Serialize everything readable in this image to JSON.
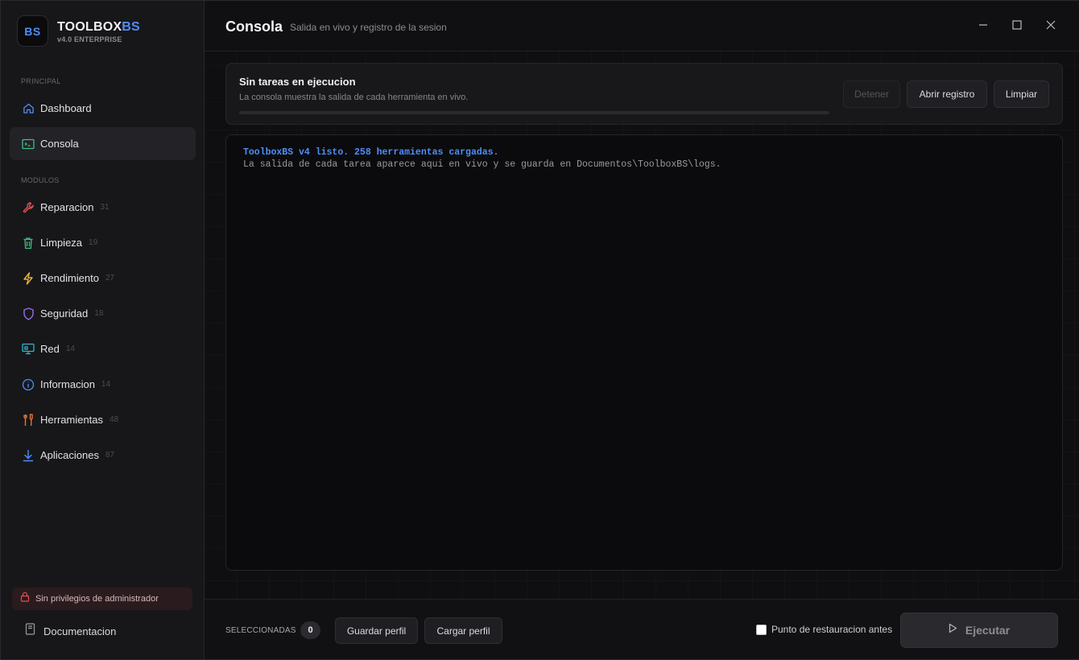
{
  "brand": {
    "logo": "BS",
    "name_main": "TOOLBOX",
    "name_accent": "BS",
    "version": "v4.0 ENTERPRISE"
  },
  "sidebar": {
    "section_principal": "PRINCIPAL",
    "section_modulos": "MODULOS",
    "principal_items": [
      {
        "label": "Dashboard",
        "icon": "home-icon",
        "color": "#4f8ef7"
      },
      {
        "label": "Consola",
        "icon": "terminal-icon",
        "color": "#3fbf7f",
        "active": true
      }
    ],
    "modules": [
      {
        "label": "Reparacion",
        "count": "31",
        "icon": "wrench-icon",
        "color": "#e0524f"
      },
      {
        "label": "Limpieza",
        "count": "19",
        "icon": "trash-icon",
        "color": "#3fbf7f"
      },
      {
        "label": "Rendimiento",
        "count": "27",
        "icon": "lightning-icon",
        "color": "#e8b235"
      },
      {
        "label": "Seguridad",
        "count": "18",
        "icon": "shield-icon",
        "color": "#9b6bf0"
      },
      {
        "label": "Red",
        "count": "14",
        "icon": "monitor-network-icon",
        "color": "#2fb5c9"
      },
      {
        "label": "Informacion",
        "count": "14",
        "icon": "info-icon",
        "color": "#4f8ef7"
      },
      {
        "label": "Herramientas",
        "count": "48",
        "icon": "tools-icon",
        "color": "#f07a3a"
      },
      {
        "label": "Aplicaciones",
        "count": "87",
        "icon": "download-icon",
        "color": "#4f8ef7"
      }
    ],
    "admin_warning": "Sin privilegios de administrador",
    "docs": "Documentacion"
  },
  "header": {
    "title": "Consola",
    "subtitle": "Salida en vivo y registro de la sesion"
  },
  "status": {
    "title": "Sin tareas en ejecucion",
    "description": "La consola muestra la salida de cada herramienta en vivo.",
    "progress": 0,
    "stop_label": "Detener",
    "open_log_label": "Abrir registro",
    "clear_label": "Limpiar"
  },
  "console": {
    "lines": [
      "ToolboxBS v4 listo. 258 herramientas cargadas.",
      "La salida de cada tarea aparece aqui en vivo y se guarda en Documentos\\ToolboxBS\\logs."
    ]
  },
  "footer": {
    "selected_label": "SELECCIONADAS",
    "selected_count": "0",
    "save_profile": "Guardar perfil",
    "load_profile": "Cargar perfil",
    "restore_point": "Punto de restauracion antes",
    "run": "Ejecutar"
  },
  "colors": {
    "accent": "#4f8ef7",
    "background": "#0f0f11",
    "sidebar": "#17171a"
  }
}
